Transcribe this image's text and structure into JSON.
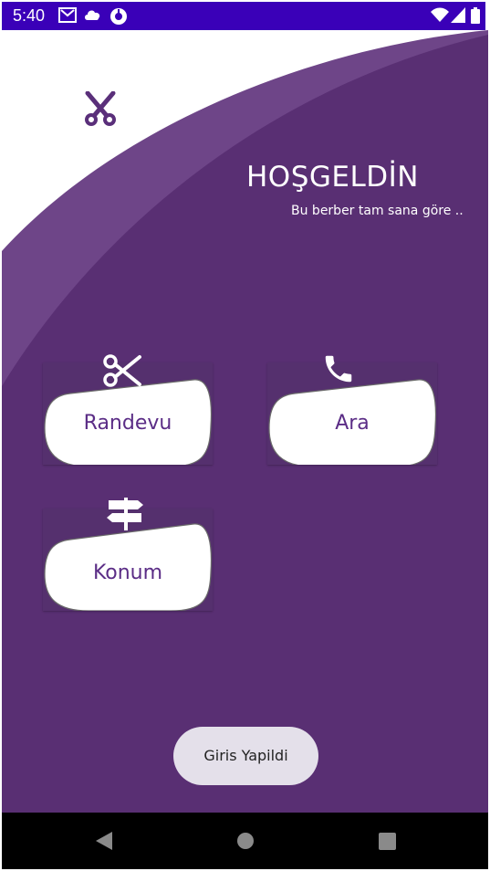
{
  "status_bar": {
    "time": "5:40",
    "color": "#3a00b8",
    "left_icons": [
      "gmail-icon",
      "cloud-icon",
      "app-notification-icon"
    ],
    "right_icons": [
      "wifi-icon",
      "signal-icon",
      "battery-icon"
    ]
  },
  "colors": {
    "background_purple": "#592f73",
    "curve_light": "#6e4588",
    "card_blob": "#ffffff",
    "label_purple": "#5b2d86"
  },
  "header": {
    "logo_icon": "scissors-icon",
    "title": "HOŞGELDİN",
    "subtitle": "Bu berber tam sana göre .."
  },
  "menu": {
    "randevu": {
      "label": "Randevu",
      "icon": "scissors-icon"
    },
    "ara": {
      "label": "Ara",
      "icon": "phone-icon"
    },
    "konum": {
      "label": "Konum",
      "icon": "signpost-icon"
    }
  },
  "toast": {
    "text": "Giris Yapildi"
  },
  "nav_bar": {
    "buttons": [
      "back-icon",
      "home-icon",
      "recents-icon"
    ]
  }
}
